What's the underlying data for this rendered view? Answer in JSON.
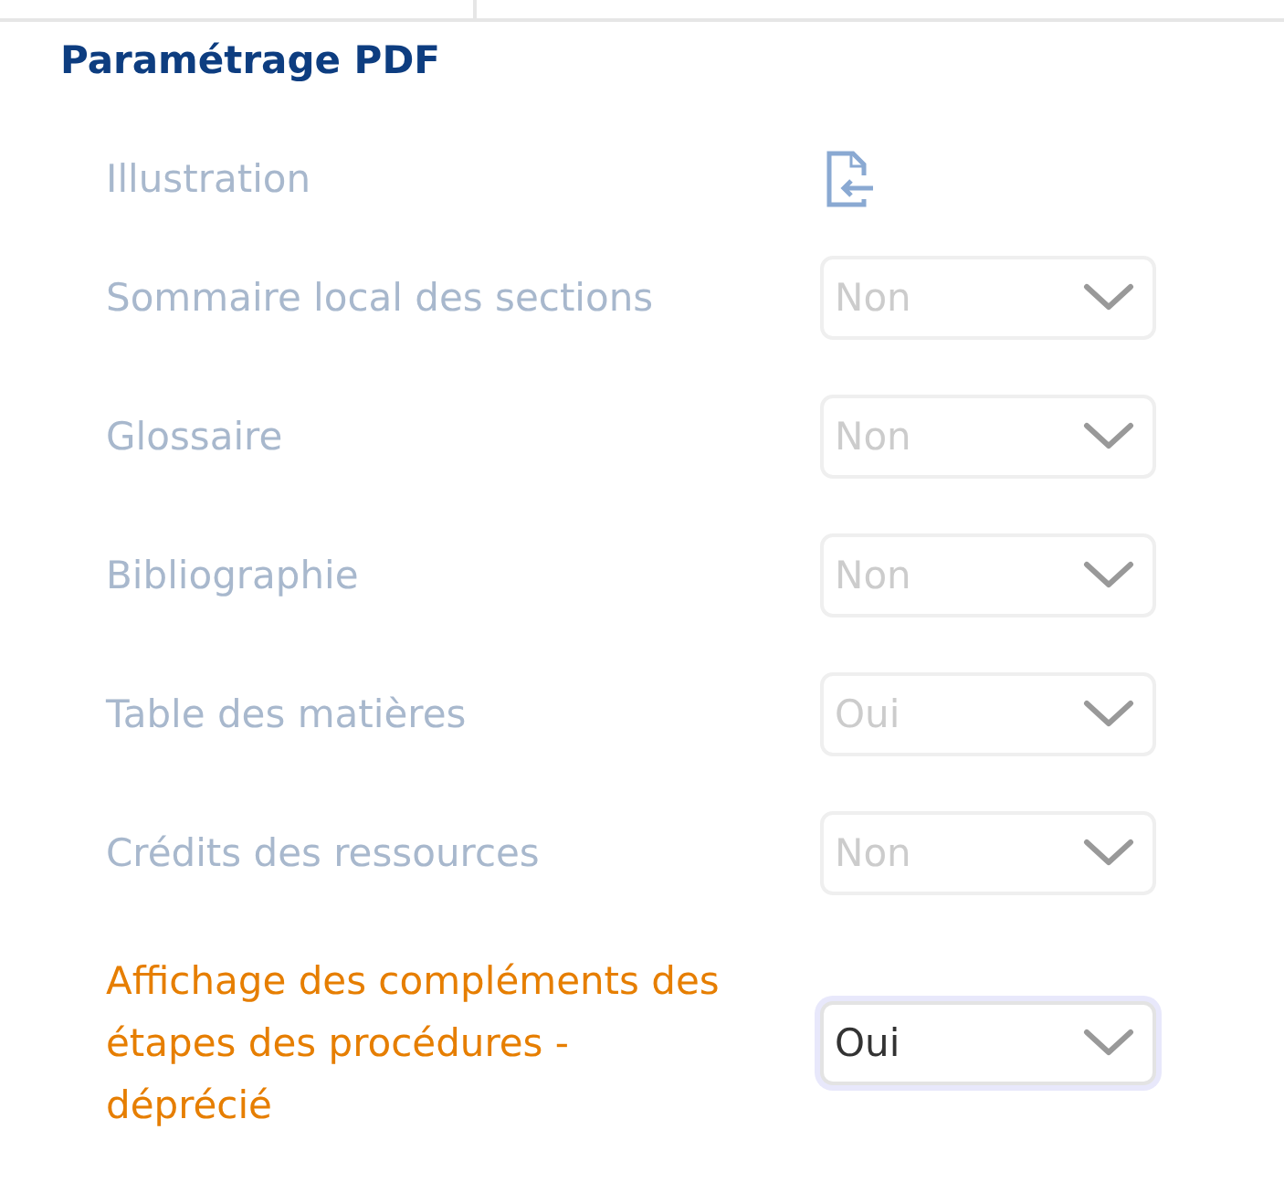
{
  "title": "Paramétrage PDF",
  "settings": [
    {
      "kind": "icon",
      "label": "Illustration",
      "disabled": true,
      "deprecated": false
    },
    {
      "kind": "select",
      "label": "Sommaire local des sections",
      "value": "Non",
      "disabled": true,
      "deprecated": false
    },
    {
      "kind": "select",
      "label": "Glossaire",
      "value": "Non",
      "disabled": true,
      "deprecated": false
    },
    {
      "kind": "select",
      "label": "Bibliographie",
      "value": "Non",
      "disabled": true,
      "deprecated": false
    },
    {
      "kind": "select",
      "label": "Table des matières",
      "value": "Oui",
      "disabled": true,
      "deprecated": false
    },
    {
      "kind": "select",
      "label": "Crédits des ressources",
      "value": "Non",
      "disabled": true,
      "deprecated": false
    },
    {
      "kind": "select",
      "label": "Affichage des compléments des étapes des procédures - déprécié",
      "value": "Oui",
      "disabled": false,
      "deprecated": true
    }
  ]
}
